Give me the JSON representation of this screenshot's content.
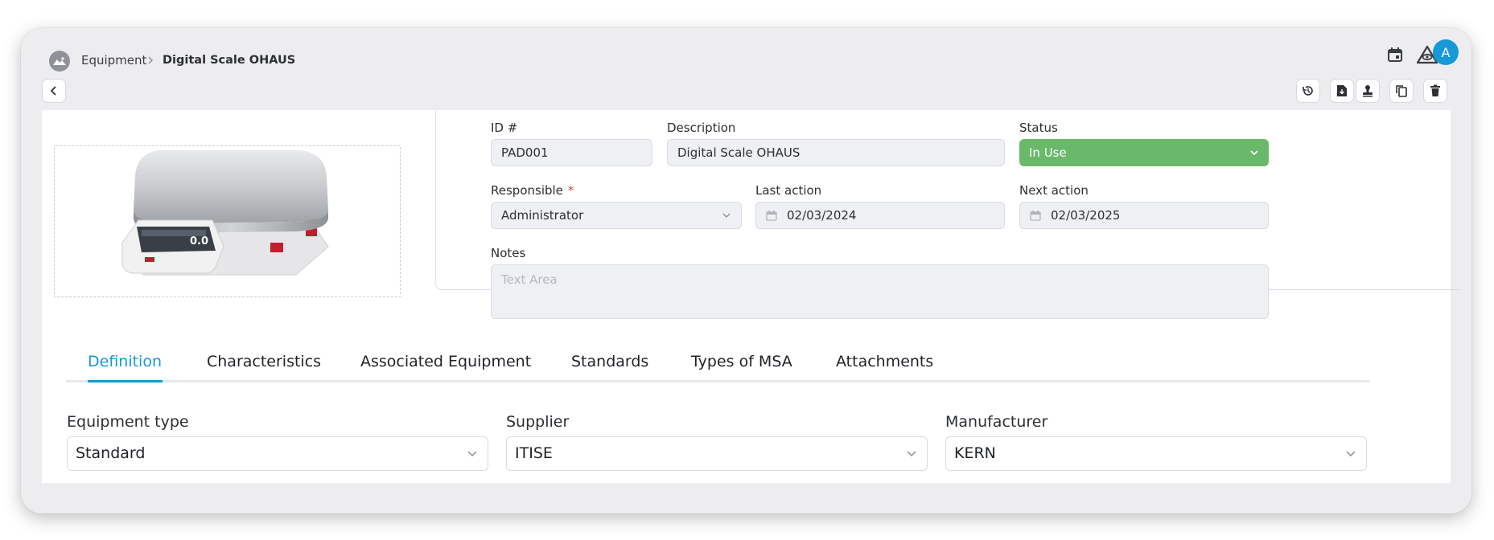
{
  "breadcrumb": {
    "parent": "Equipment",
    "current": "Digital Scale OHAUS"
  },
  "user": {
    "avatar_initial": "A"
  },
  "colors": {
    "accent": "#1699d6",
    "status_in_use": "#6ab96a",
    "required": "#e0463b"
  },
  "icons": {
    "app_logo": "mountain-logo-icon",
    "calendar": "calendar-icon",
    "triangle": "triangle-eye-icon",
    "back": "chevron-left-icon",
    "history": "history-icon",
    "download_doc": "download-document-icon",
    "stamp": "stamp-icon",
    "copy": "copy-icon",
    "delete": "trash-icon"
  },
  "form": {
    "id_label": "ID #",
    "id_value": "PAD001",
    "description_label": "Description",
    "description_value": "Digital Scale OHAUS",
    "status_label": "Status",
    "status_value": "In Use",
    "responsible_label": "Responsible",
    "responsible_required": "*",
    "responsible_value": "Administrator",
    "last_action_label": "Last action",
    "last_action_value": "02/03/2024",
    "next_action_label": "Next action",
    "next_action_value": "02/03/2025",
    "notes_label": "Notes",
    "notes_placeholder": "Text Area"
  },
  "scale_display": "0.0",
  "tabs": [
    {
      "label": "Definition",
      "active": true
    },
    {
      "label": "Characteristics",
      "active": false
    },
    {
      "label": "Associated Equipment",
      "active": false
    },
    {
      "label": "Standards",
      "active": false
    },
    {
      "label": "Types of MSA",
      "active": false
    },
    {
      "label": "Attachments",
      "active": false
    }
  ],
  "definition": {
    "equipment_type_label": "Equipment type",
    "equipment_type_value": "Standard",
    "supplier_label": "Supplier",
    "supplier_value": "ITISE",
    "manufacturer_label": "Manufacturer",
    "manufacturer_value": "KERN"
  }
}
